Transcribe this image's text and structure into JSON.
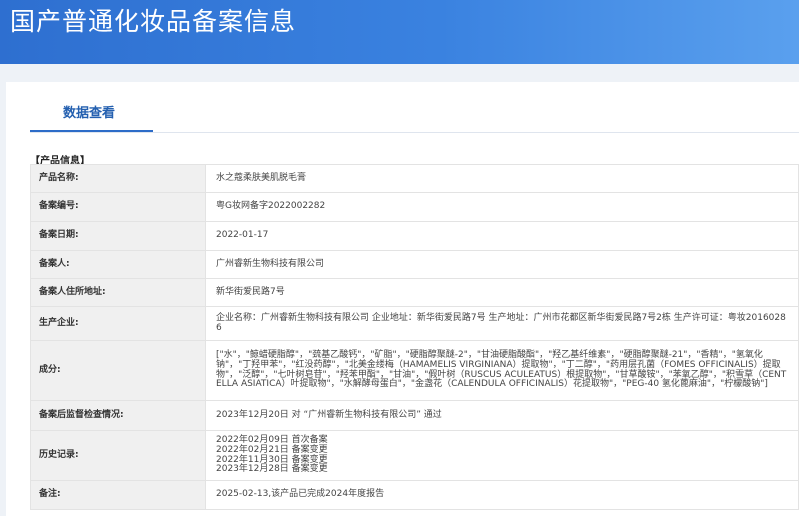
{
  "header": {
    "title": "国产普通化妆品备案信息"
  },
  "tabs": [
    {
      "label": "数据查看"
    }
  ],
  "section": {
    "title": "【产品信息】"
  },
  "rows": [
    {
      "label": "产品名称:",
      "value": "水之蔻柔肤美肌脱毛膏"
    },
    {
      "label": "备案编号:",
      "value": "粤G妆网备字2022002282"
    },
    {
      "label": "备案日期:",
      "value": "2022-01-17"
    },
    {
      "label": "备案人:",
      "value": "广州睿新生物科技有限公司"
    },
    {
      "label": "备案人住所地址:",
      "value": "新华街爱民路7号"
    },
    {
      "label": "生产企业:",
      "value": "企业名称：广州睿新生物科技有限公司 企业地址：新华街爱民路7号 生产地址：广州市花都区新华街爱民路7号2栋 生产许可证：粤妆20160286"
    },
    {
      "label": "成分:",
      "value": "[\"水\"，\"鲸蜡硬脂醇\"，\"巯基乙酸钙\"，\"矿脂\"，\"硬脂醇聚醚-2\"，\"甘油硬脂酸酯\"，\"羟乙基纤维素\"，\"硬脂醇聚醚-21\"，\"香精\"，\"氢氧化钠\"，\"丁羟甲苯\"，\"红没药醇\"，\"北美金缕梅（HAMAMELIS VIRGINIANA）提取物\"，\"丁二醇\"，\"药用层孔菌（FOMES OFFICINALIS）提取物\"，\"泛醇\"，\"七叶树皂苷\"，\"羟苯甲酯\"，\"甘油\"，\"假叶树（RUSCUS ACULEATUS）根提取物\"，\"甘草酸铵\"，\"苯氧乙醇\"，\"积雪草（CENTELLA ASIATICA）叶提取物\"，\"水解酵母蛋白\"，\"金盏花（CALENDULA OFFICINALIS）花提取物\"，\"PEG-40 氢化蓖麻油\"，\"柠檬酸钠\"]"
    },
    {
      "label": "备案后监督检查情况:",
      "value": "2023年12月20日 对 “广州睿新生物科技有限公司” 通过"
    },
    {
      "label": "历史记录:",
      "history": [
        "2022年02月09日 首次备案",
        "2022年02月21日 备案变更",
        "2022年11月30日 备案变更",
        "2023年12月28日 备案变更"
      ]
    },
    {
      "label": "备注:",
      "value": "2025-02-13,该产品已完成2024年度报告"
    }
  ]
}
